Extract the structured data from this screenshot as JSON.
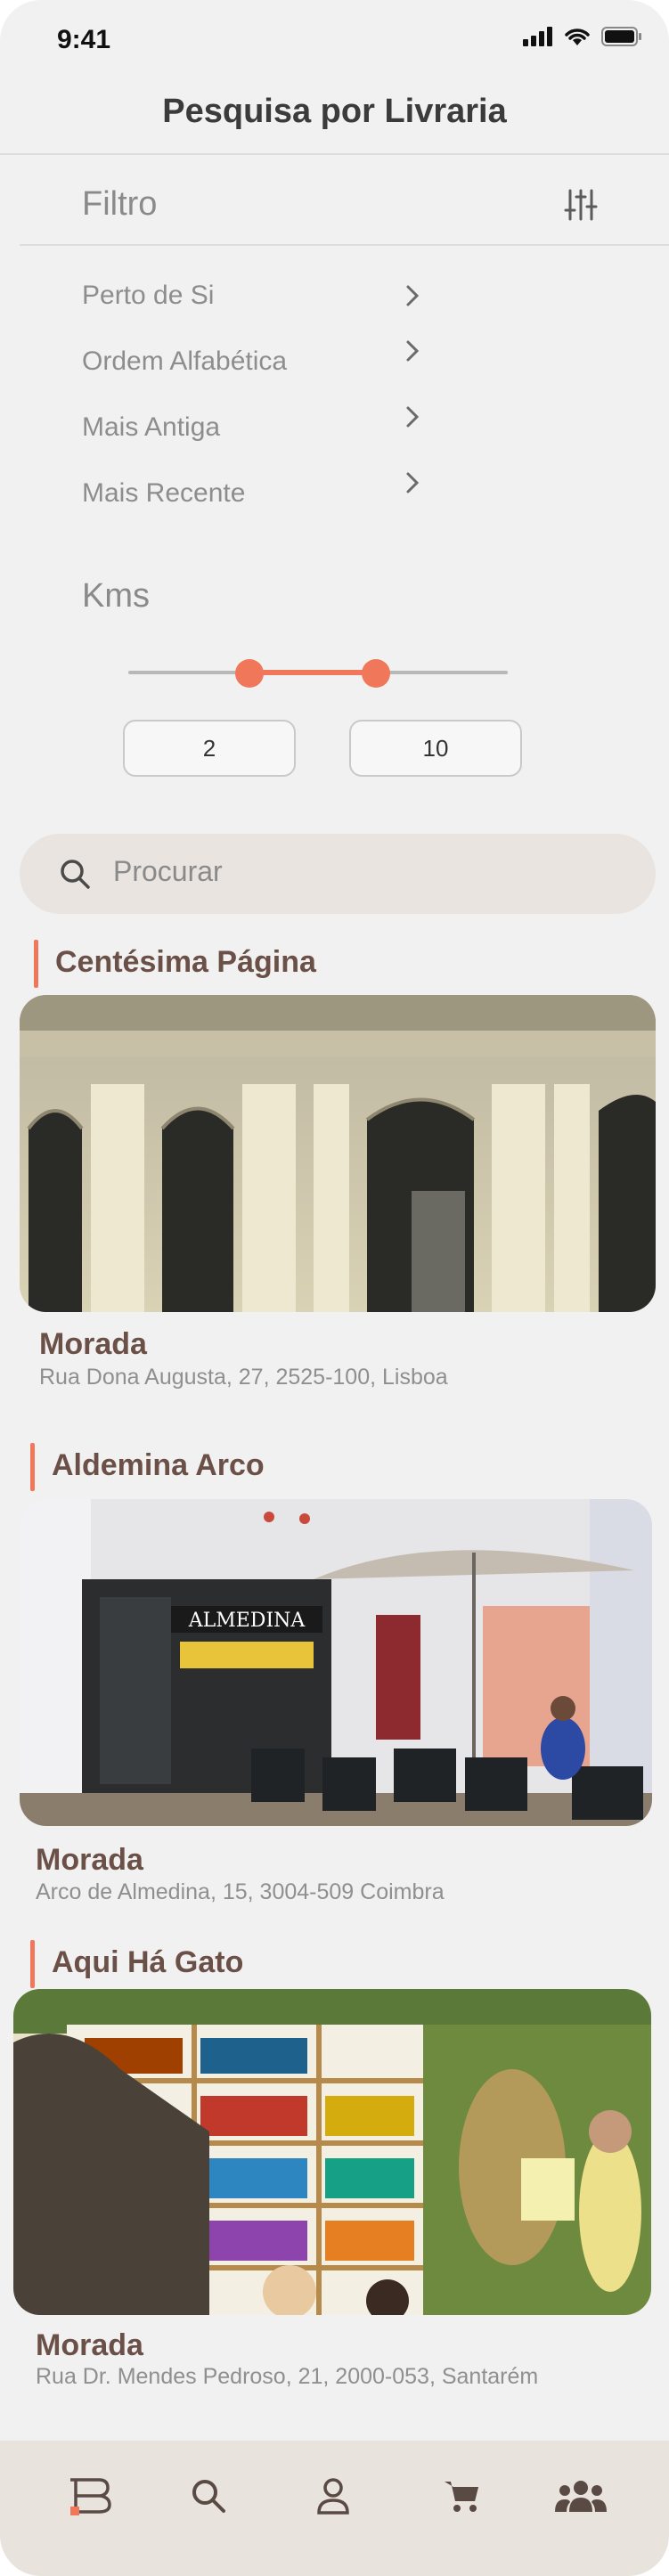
{
  "status_bar": {
    "time": "9:41"
  },
  "header": {
    "title": "Pesquisa por Livraria"
  },
  "filter": {
    "label": "Filtro",
    "options": [
      "Perto de Si",
      "Ordem Alfabética",
      "Mais Antiga",
      "Mais Recente"
    ],
    "kms_label": "Kms",
    "kms_min": "2",
    "kms_max": "10"
  },
  "search": {
    "placeholder": "Procurar"
  },
  "stores": [
    {
      "name": "Centésima Página",
      "address_label": "Morada",
      "address": "Rua Dona Augusta, 27, 2525-100, Lisboa"
    },
    {
      "name": "Aldemina Arco",
      "sign": "ALMEDINA",
      "address_label": "Morada",
      "address": "Arco de Almedina, 15, 3004-509 Coimbra"
    },
    {
      "name": "Aqui Há Gato",
      "address_label": "Morada",
      "address": "Rua Dr. Mendes Pedroso, 21, 2000-053, Santarém"
    }
  ],
  "tabbar": {
    "icons": [
      "home-logo-icon",
      "search-icon",
      "profile-icon",
      "cart-icon",
      "community-icon"
    ]
  },
  "colors": {
    "accent": "#f0775a",
    "brand_text": "#6b5048",
    "background": "#f2f1f1"
  }
}
